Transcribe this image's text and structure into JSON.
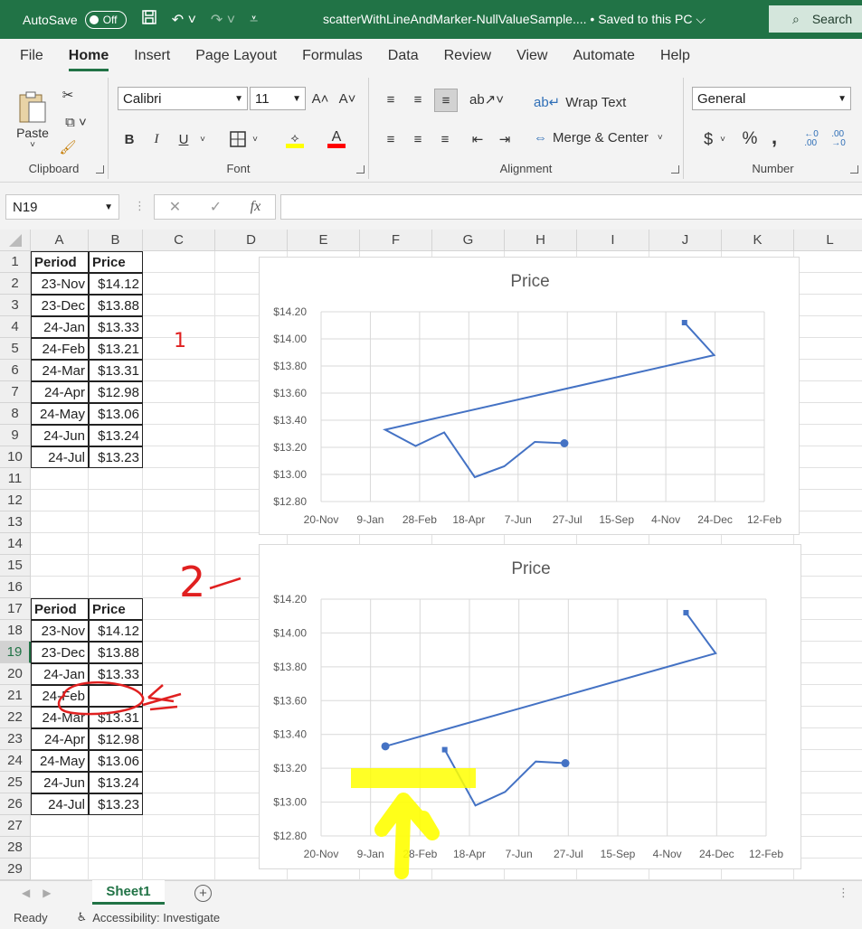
{
  "titlebar": {
    "autosave_label": "AutoSave",
    "autosave_state": "Off",
    "doc_title": "scatterWithLineAndMarker-NullValueSample.... • Saved to this PC",
    "search_placeholder": "Search"
  },
  "menu": {
    "tabs": [
      "File",
      "Home",
      "Insert",
      "Page Layout",
      "Formulas",
      "Data",
      "Review",
      "View",
      "Automate",
      "Help"
    ],
    "active": "Home"
  },
  "ribbon": {
    "clipboard": {
      "label": "Clipboard",
      "paste": "Paste"
    },
    "font": {
      "label": "Font",
      "name": "Calibri",
      "size": "11",
      "bold": "B",
      "italic": "I",
      "underline": "U"
    },
    "alignment": {
      "label": "Alignment",
      "wrap": "Wrap Text",
      "merge": "Merge & Center"
    },
    "number": {
      "label": "Number",
      "format": "General",
      "currency": "$",
      "percent": "%",
      "comma": ","
    }
  },
  "formula_bar": {
    "name_box": "N19",
    "fx": "fx",
    "formula": ""
  },
  "columns": [
    "A",
    "B",
    "C",
    "D",
    "E",
    "F",
    "G",
    "H",
    "I",
    "J",
    "K",
    "L"
  ],
  "rows": [
    "1",
    "2",
    "3",
    "4",
    "5",
    "6",
    "7",
    "8",
    "9",
    "10",
    "11",
    "12",
    "13",
    "14",
    "15",
    "16",
    "17",
    "18",
    "19",
    "20",
    "21",
    "22",
    "23",
    "24",
    "25",
    "26",
    "27",
    "28",
    "29"
  ],
  "table1": {
    "headers": [
      "Period",
      "Price"
    ],
    "rows": [
      [
        "23-Nov",
        "$14.12"
      ],
      [
        "23-Dec",
        "$13.88"
      ],
      [
        "24-Jan",
        "$13.33"
      ],
      [
        "24-Feb",
        "$13.21"
      ],
      [
        "24-Mar",
        "$13.31"
      ],
      [
        "24-Apr",
        "$12.98"
      ],
      [
        "24-May",
        "$13.06"
      ],
      [
        "24-Jun",
        "$13.24"
      ],
      [
        "24-Jul",
        "$13.23"
      ]
    ]
  },
  "table2": {
    "headers": [
      "Period",
      "Price"
    ],
    "rows": [
      [
        "23-Nov",
        "$14.12"
      ],
      [
        "23-Dec",
        "$13.88"
      ],
      [
        "24-Jan",
        "$13.33"
      ],
      [
        "24-Feb",
        ""
      ],
      [
        "24-Mar",
        "$13.31"
      ],
      [
        "24-Apr",
        "$12.98"
      ],
      [
        "24-May",
        "$13.06"
      ],
      [
        "24-Jun",
        "$13.24"
      ],
      [
        "24-Jul",
        "$13.23"
      ]
    ]
  },
  "annotations": {
    "label1": "1",
    "label2": "2"
  },
  "chart_data": [
    {
      "type": "scatter",
      "title": "Price",
      "x_ticks": [
        "20-Nov",
        "9-Jan",
        "28-Feb",
        "18-Apr",
        "7-Jun",
        "27-Jul",
        "15-Sep",
        "4-Nov",
        "24-Dec",
        "12-Feb"
      ],
      "y_ticks": [
        "$14.20",
        "$14.00",
        "$13.80",
        "$13.60",
        "$13.40",
        "$13.20",
        "$13.00",
        "$12.80"
      ],
      "ylim": [
        12.8,
        14.2
      ],
      "x_range": [
        "2023-11-20",
        "2025-02-12"
      ],
      "grid": true,
      "color": "#4472c4",
      "segments": [
        [
          {
            "x": "2024-11-23",
            "y": 14.12
          },
          {
            "x": "2024-12-23",
            "y": 13.88
          },
          {
            "x": "2024-01-24",
            "y": 13.33
          },
          {
            "x": "2024-02-24",
            "y": 13.21
          },
          {
            "x": "2024-03-24",
            "y": 13.31
          },
          {
            "x": "2024-04-24",
            "y": 12.98
          },
          {
            "x": "2024-05-24",
            "y": 13.06
          },
          {
            "x": "2024-06-24",
            "y": 13.24
          },
          {
            "x": "2024-07-24",
            "y": 13.23
          }
        ]
      ]
    },
    {
      "type": "scatter",
      "title": "Price",
      "x_ticks": [
        "20-Nov",
        "9-Jan",
        "28-Feb",
        "18-Apr",
        "7-Jun",
        "27-Jul",
        "15-Sep",
        "4-Nov",
        "24-Dec",
        "12-Feb"
      ],
      "y_ticks": [
        "$14.20",
        "$14.00",
        "$13.80",
        "$13.60",
        "$13.40",
        "$13.20",
        "$13.00",
        "$12.80"
      ],
      "ylim": [
        12.8,
        14.2
      ],
      "x_range": [
        "2023-11-20",
        "2025-02-12"
      ],
      "grid": true,
      "color": "#4472c4",
      "segments": [
        [
          {
            "x": "2024-11-23",
            "y": 14.12
          },
          {
            "x": "2024-12-23",
            "y": 13.88
          },
          {
            "x": "2024-01-24",
            "y": 13.33
          }
        ],
        [
          {
            "x": "2024-03-24",
            "y": 13.31
          },
          {
            "x": "2024-04-24",
            "y": 12.98
          },
          {
            "x": "2024-05-24",
            "y": 13.06
          },
          {
            "x": "2024-06-24",
            "y": 13.24
          },
          {
            "x": "2024-07-24",
            "y": 13.23
          }
        ]
      ]
    }
  ],
  "sheet_tabs": {
    "active": "Sheet1"
  },
  "statusbar": {
    "ready": "Ready",
    "accessibility": "Accessibility: Investigate"
  }
}
